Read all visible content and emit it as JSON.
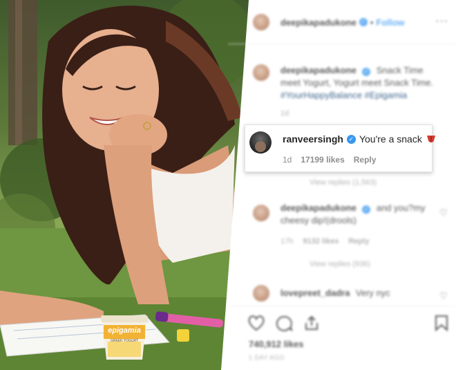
{
  "post": {
    "username": "deepikapadukone",
    "follow_label": "Follow",
    "caption": "Snack Time meet Yogurt, Yogurt meet Snack Time.",
    "hashtags": "#YourHappyBalance #Epigamia",
    "caption_age": "1d",
    "likes_count": "740,912 likes",
    "post_age": "1 DAY AGO"
  },
  "product": {
    "brand": "epigamia",
    "flavor": "GREEK YOGURT"
  },
  "highlighted_comment": {
    "username": "ranveersingh",
    "text": "You're a snack",
    "age": "1d",
    "likes": "17199 likes",
    "reply_label": "Reply"
  },
  "view_replies_1": "View replies (1,563)",
  "second_comment": {
    "username": "deepikapadukone",
    "text": "and you?my cheesy dip!(drools)",
    "age": "17h",
    "likes": "9132 likes",
    "reply_label": "Reply",
    "view_replies": "View replies (936)"
  },
  "third_comment": {
    "username": "lovepreet_dadra",
    "text": "Very nyc"
  },
  "icons": [
    "heart-icon",
    "comment-icon",
    "share-icon",
    "bookmark-icon",
    "more-icon",
    "verified-badge-icon",
    "tongue-emoji-icon"
  ],
  "colors": {
    "accent": "#3897f0",
    "text": "#262626",
    "muted": "#8e8e8e"
  }
}
